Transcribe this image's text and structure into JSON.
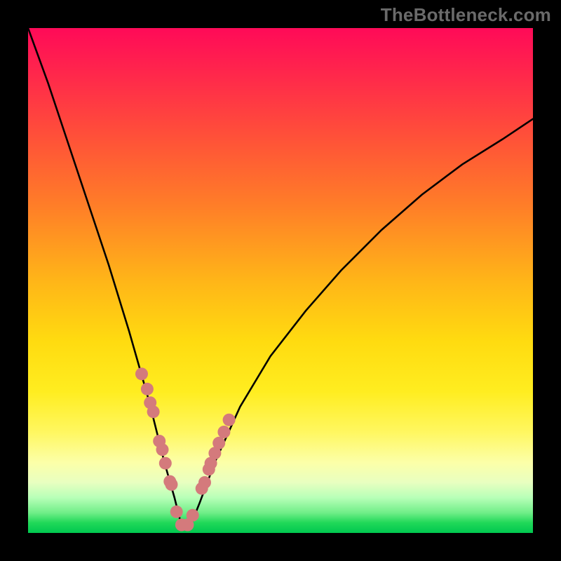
{
  "watermark": "TheBottleneck.com",
  "chart_data": {
    "type": "line",
    "title": "",
    "xlabel": "",
    "ylabel": "",
    "xlim": [
      0,
      100
    ],
    "ylim": [
      0,
      100
    ],
    "grid": false,
    "legend": false,
    "background_gradient": {
      "top_color": "#ff0a58",
      "mid_color": "#ffdb10",
      "bottom_color": "#00c850"
    },
    "series": [
      {
        "name": "bottleneck-curve",
        "x": [
          0,
          4,
          8,
          12,
          16,
          20,
          24,
          27,
          29,
          30.5,
          32,
          34,
          37,
          42,
          48,
          55,
          62,
          70,
          78,
          86,
          94,
          100
        ],
        "y": [
          100,
          89,
          77,
          65,
          53,
          40,
          26,
          14,
          7,
          1,
          1,
          6,
          14,
          25,
          35,
          44,
          52,
          60,
          67,
          73,
          78,
          82
        ]
      }
    ],
    "points": {
      "name": "highlight-markers",
      "color": "#d47a7c",
      "x": [
        22.5,
        23.6,
        24.2,
        24.8,
        26.0,
        26.6,
        27.2,
        28.1,
        28.4,
        29.4,
        30.4,
        31.6,
        32.6,
        34.4,
        35.0,
        35.8,
        36.2,
        37.0,
        37.8,
        38.8,
        39.8
      ],
      "y": [
        31.5,
        28.5,
        25.8,
        24.0,
        18.2,
        16.5,
        13.8,
        10.2,
        9.6,
        4.2,
        1.6,
        1.6,
        3.5,
        8.8,
        10.0,
        12.6,
        13.8,
        15.8,
        17.8,
        20.0,
        22.4
      ]
    }
  }
}
